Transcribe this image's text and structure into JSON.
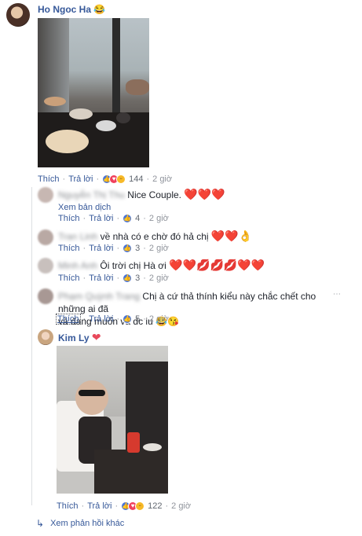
{
  "post": {
    "author": "Ho Ngoc Ha",
    "author_emoji": "😂",
    "actions": {
      "like": "Thích",
      "reply": "Trả lời"
    },
    "reactions_count": "144",
    "time": "2 giờ"
  },
  "replies": [
    {
      "name": "Nguyễn Thị Thu",
      "text": "Nice Couple.",
      "hearts": "❤️❤️❤️",
      "translate": "Xem bản dịch",
      "like": "Thích",
      "reply": "Trả lời",
      "count": "4",
      "time": "2 giờ"
    },
    {
      "name": "Tran Linh",
      "text": "về nhà có e chờ đó hả chị",
      "hearts": "❤️❤️👌",
      "like": "Thích",
      "reply": "Trả lời",
      "count": "3",
      "time": "2 giờ"
    },
    {
      "name": "Minh Anh",
      "text": "Ôi trời chị Hà ơi",
      "hearts": "❤️❤️💋💋💋❤️❤️",
      "like": "Thích",
      "reply": "Trả lời",
      "count": "3",
      "time": "2 giờ"
    },
    {
      "name": "Phạm Quỳnh Trang",
      "text": "Chị à cứ thả thính kiểu này chắc chết cho những ai đã",
      "text2": "và đang muốn và dc iu",
      "emojis": "😂😘",
      "like": "Thích",
      "reply": "Trả lời",
      "count": "5",
      "time": "2 giờ"
    },
    {
      "name": "Kim Ly",
      "name_emoji": "❤",
      "like": "Thích",
      "reply": "Trả lời",
      "count": "122",
      "time": "2 giờ"
    }
  ],
  "more_replies": "Xem phản hồi khác",
  "colors": {
    "link": "#365899",
    "meta": "#90949c",
    "heart": "#e8495b",
    "like": "#4a76d9"
  }
}
